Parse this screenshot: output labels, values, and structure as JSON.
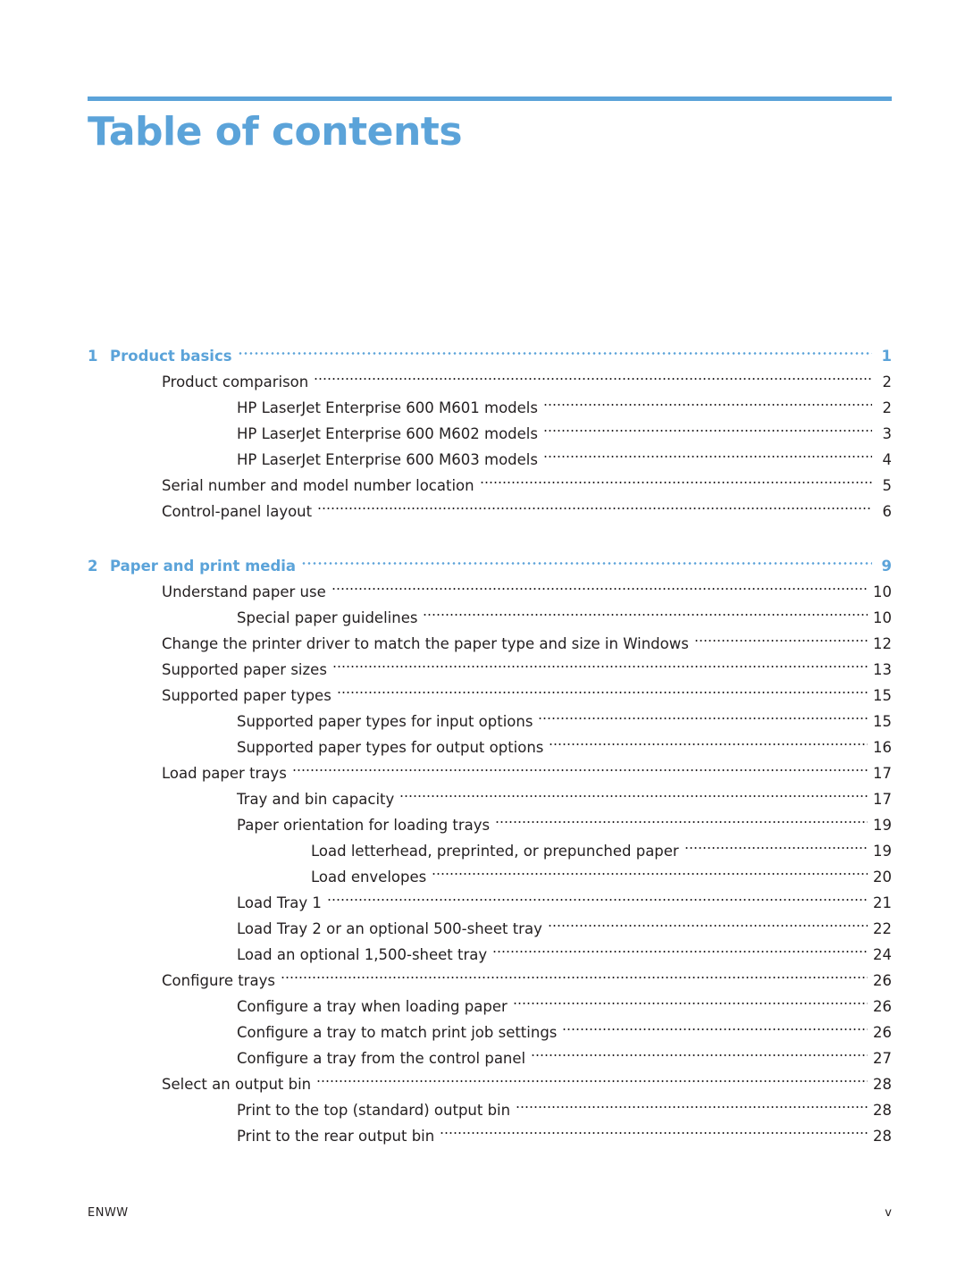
{
  "page": {
    "title": "Table of contents",
    "accent_color": "#5ba3d9",
    "footer_left": "ENWW",
    "footer_right": "v"
  },
  "toc": [
    {
      "type": "chapter",
      "number": "1",
      "title": "Product basics",
      "page": "1"
    },
    {
      "type": "entry",
      "level": 1,
      "title": "Product comparison",
      "page": "2"
    },
    {
      "type": "entry",
      "level": 2,
      "title": "HP LaserJet Enterprise 600 M601 models",
      "page": "2"
    },
    {
      "type": "entry",
      "level": 2,
      "title": "HP LaserJet Enterprise 600 M602 models",
      "page": "3"
    },
    {
      "type": "entry",
      "level": 2,
      "title": "HP LaserJet Enterprise 600 M603 models",
      "page": "4"
    },
    {
      "type": "entry",
      "level": 1,
      "title": "Serial number and model number location",
      "page": "5"
    },
    {
      "type": "entry",
      "level": 1,
      "title": "Control-panel layout",
      "page": "6"
    },
    {
      "type": "chapter",
      "number": "2",
      "title": "Paper and print media",
      "page": "9"
    },
    {
      "type": "entry",
      "level": 1,
      "title": "Understand paper use",
      "page": "10"
    },
    {
      "type": "entry",
      "level": 2,
      "title": "Special paper guidelines",
      "page": "10"
    },
    {
      "type": "entry",
      "level": 1,
      "title": "Change the printer driver to match the paper type and size in Windows",
      "page": "12"
    },
    {
      "type": "entry",
      "level": 1,
      "title": "Supported paper sizes",
      "page": "13"
    },
    {
      "type": "entry",
      "level": 1,
      "title": "Supported paper types",
      "page": "15"
    },
    {
      "type": "entry",
      "level": 2,
      "title": "Supported paper types for input options",
      "page": "15"
    },
    {
      "type": "entry",
      "level": 2,
      "title": "Supported paper types for output options",
      "page": "16"
    },
    {
      "type": "entry",
      "level": 1,
      "title": "Load paper trays",
      "page": "17"
    },
    {
      "type": "entry",
      "level": 2,
      "title": "Tray and bin capacity",
      "page": "17"
    },
    {
      "type": "entry",
      "level": 2,
      "title": "Paper orientation for loading trays",
      "page": "19"
    },
    {
      "type": "entry",
      "level": 3,
      "title": "Load letterhead, preprinted, or prepunched paper",
      "page": "19"
    },
    {
      "type": "entry",
      "level": 3,
      "title": "Load envelopes",
      "page": "20"
    },
    {
      "type": "entry",
      "level": 2,
      "title": "Load Tray 1",
      "page": "21"
    },
    {
      "type": "entry",
      "level": 2,
      "title": "Load Tray 2 or an optional 500-sheet tray",
      "page": "22"
    },
    {
      "type": "entry",
      "level": 2,
      "title": "Load an optional 1,500-sheet tray",
      "page": "24"
    },
    {
      "type": "entry",
      "level": 1,
      "title": "Configure trays",
      "page": "26"
    },
    {
      "type": "entry",
      "level": 2,
      "title": "Configure a tray when loading paper",
      "page": "26"
    },
    {
      "type": "entry",
      "level": 2,
      "title": "Configure a tray to match print job settings",
      "page": "26"
    },
    {
      "type": "entry",
      "level": 2,
      "title": "Configure a tray from the control panel",
      "page": "27"
    },
    {
      "type": "entry",
      "level": 1,
      "title": "Select an output bin",
      "page": "28"
    },
    {
      "type": "entry",
      "level": 2,
      "title": "Print to the top (standard) output bin",
      "page": "28"
    },
    {
      "type": "entry",
      "level": 2,
      "title": "Print to the rear output bin",
      "page": "28"
    }
  ]
}
